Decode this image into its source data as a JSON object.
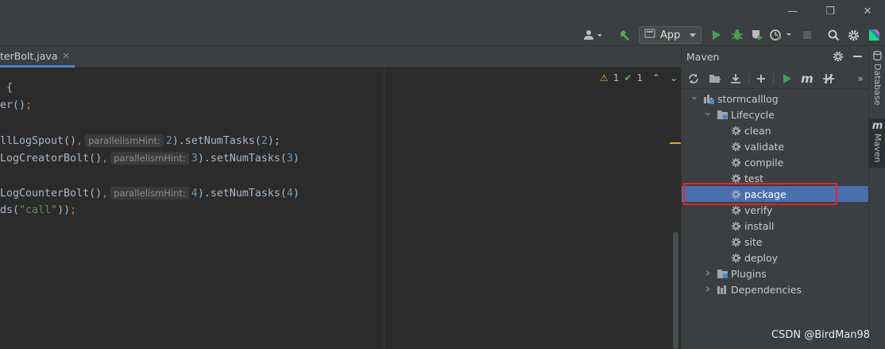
{
  "window": {
    "controls": {
      "minimize": "—",
      "restore": "❐",
      "close": "✕"
    }
  },
  "toolbar": {
    "run_config": "App",
    "icons": [
      "user-icon",
      "build-hammer-icon",
      "run-icon",
      "debug-icon",
      "coverage-icon",
      "profile-icon",
      "stop-icon",
      "search-icon",
      "settings-icon",
      "jetbrains-logo-icon"
    ]
  },
  "editor": {
    "tab": {
      "name": "terBolt.java",
      "close": "✕"
    },
    "inspection": {
      "warnings": "1",
      "checks": "1",
      "up": "⌃",
      "down": "⌄"
    },
    "lines": [
      {
        "parts": [
          {
            "t": " {",
            "c": "plain"
          }
        ]
      },
      {
        "parts": [
          {
            "t": "er()",
            "c": "plain"
          },
          {
            "t": ";",
            "c": "punct"
          }
        ]
      },
      {
        "parts": []
      },
      {
        "parts": [
          {
            "t": "llLogSpout()",
            "c": "plain"
          },
          {
            "t": ",",
            "c": "punct"
          },
          {
            "t": "parallelismHint:",
            "c": "hint"
          },
          {
            "t": "2",
            "c": "num"
          },
          {
            "t": ").setNumTasks(",
            "c": "plain"
          },
          {
            "t": "2",
            "c": "num"
          },
          {
            "t": ");",
            "c": "plain"
          }
        ]
      },
      {
        "parts": [
          {
            "t": "LogCreatorBolt()",
            "c": "plain"
          },
          {
            "t": ",",
            "c": "punct"
          },
          {
            "t": "parallelismHint:",
            "c": "hint"
          },
          {
            "t": "3",
            "c": "num"
          },
          {
            "t": ").setNumTasks(",
            "c": "plain"
          },
          {
            "t": "3",
            "c": "num"
          },
          {
            "t": ")",
            "c": "plain"
          }
        ]
      },
      {
        "parts": []
      },
      {
        "parts": [
          {
            "t": "LogCounterBolt()",
            "c": "plain"
          },
          {
            "t": ",",
            "c": "punct"
          },
          {
            "t": "parallelismHint:",
            "c": "hint"
          },
          {
            "t": "4",
            "c": "num"
          },
          {
            "t": ").setNumTasks(",
            "c": "plain"
          },
          {
            "t": "4",
            "c": "num"
          },
          {
            "t": ")",
            "c": "plain"
          }
        ]
      },
      {
        "parts": [
          {
            "t": "ds(",
            "c": "plain"
          },
          {
            "t": "\"call\"",
            "c": "str"
          },
          {
            "t": "))",
            "c": "plain"
          },
          {
            "t": ";",
            "c": "punct"
          }
        ]
      }
    ]
  },
  "maven": {
    "title": "Maven",
    "toolbar_icons": [
      "reload-icon",
      "add-folder-icon",
      "download-icon",
      "plus-icon",
      "run-icon",
      "maven-m-icon",
      "skip-tests-icon",
      "more-icon"
    ],
    "tree": [
      {
        "label": "stormcalllog",
        "level": 0,
        "expanded": true,
        "icon": "maven-project-icon"
      },
      {
        "label": "Lifecycle",
        "level": 1,
        "expanded": true,
        "icon": "lifecycle-folder-icon"
      },
      {
        "label": "clean",
        "level": 2,
        "icon": "gear-icon"
      },
      {
        "label": "validate",
        "level": 2,
        "icon": "gear-icon"
      },
      {
        "label": "compile",
        "level": 2,
        "icon": "gear-icon"
      },
      {
        "label": "test",
        "level": 2,
        "icon": "gear-icon"
      },
      {
        "label": "package",
        "level": 2,
        "icon": "gear-icon",
        "selected": true
      },
      {
        "label": "verify",
        "level": 2,
        "icon": "gear-icon"
      },
      {
        "label": "install",
        "level": 2,
        "icon": "gear-icon"
      },
      {
        "label": "site",
        "level": 2,
        "icon": "gear-icon"
      },
      {
        "label": "deploy",
        "level": 2,
        "icon": "gear-icon"
      },
      {
        "label": "Plugins",
        "level": 1,
        "expanded": false,
        "icon": "plugins-folder-icon"
      },
      {
        "label": "Dependencies",
        "level": 1,
        "expanded": false,
        "icon": "dependencies-folder-icon"
      }
    ]
  },
  "stripe": {
    "database": "Database",
    "maven": "Maven",
    "maven_m": "m"
  },
  "watermark": "CSDN @BirdMan98"
}
